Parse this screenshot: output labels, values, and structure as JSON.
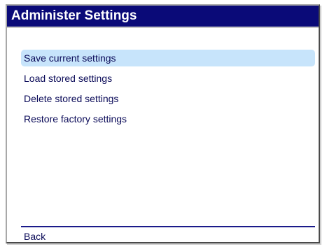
{
  "dialog": {
    "title": "Administer Settings"
  },
  "menu": {
    "items": [
      {
        "label": "Save current settings",
        "selected": true
      },
      {
        "label": "Load stored settings",
        "selected": false
      },
      {
        "label": "Delete stored settings",
        "selected": false
      },
      {
        "label": "Restore factory settings",
        "selected": false
      }
    ]
  },
  "footer": {
    "back_label": "Back"
  },
  "colors": {
    "title_bar": "#0a0a78",
    "selection": "#c7e4fb",
    "text": "#0a0a58"
  }
}
